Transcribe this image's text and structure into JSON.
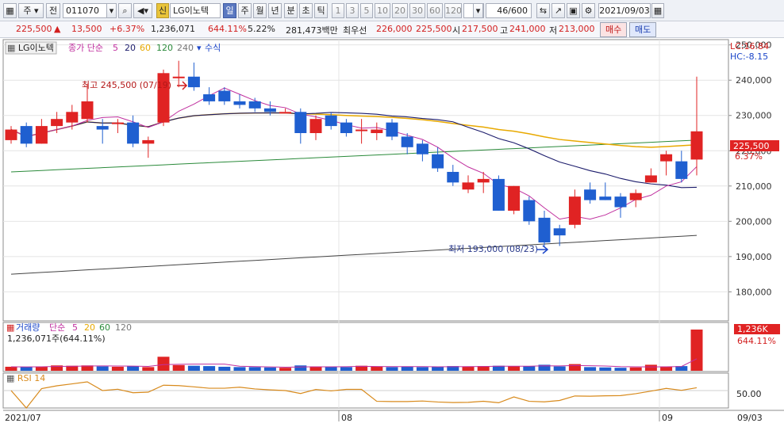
{
  "toolbar": {
    "period_type": "주",
    "prev_label": "전",
    "code": "011070",
    "stock_tag": "신",
    "stock_name": "LG이노텍",
    "intervals": [
      "일",
      "주",
      "월",
      "년",
      "분",
      "초",
      "틱"
    ],
    "selected_interval": "일",
    "numbers": [
      "1",
      "3",
      "5",
      "10",
      "20",
      "30",
      "60",
      "120"
    ],
    "count": "46/600",
    "date": "2021/09/03"
  },
  "quote": {
    "price": "225,500",
    "change_arrow": "▲",
    "change": "13,500",
    "change_rate": "+6.37%",
    "volume": "1,236,071",
    "volume_rate": "644.11%",
    "turnover": "5.22%",
    "amount": "281,473백만",
    "best_label": "최우선",
    "best_ask": "226,000",
    "best_bid": "225,500",
    "open_label": "시",
    "open": "217,500",
    "high_label": "고",
    "high": "241,000",
    "low_label": "저",
    "low": "213,000",
    "buy_label": "매수",
    "sell_label": "매도"
  },
  "chart": {
    "price_legend": {
      "name": "LG이노텍",
      "ma_label": "종가 단순",
      "ma_periods": [
        "5",
        "20",
        "60",
        "120",
        "240"
      ],
      "formula_label": "수식"
    },
    "corner_info": {
      "lc": "LC:16.84",
      "hc": "HC:-8.15"
    },
    "current_price_tag": "225,500",
    "current_rate_tag": "6.37%",
    "high_annotation": "최고 245,500 (07/19)",
    "low_annotation": "최저 193,000 (08/23)",
    "volume_legend": {
      "name": "거래량",
      "ma_label": "단순",
      "ma_periods": [
        "5",
        "20",
        "60",
        "120"
      ],
      "value_text": "1,236,071주(644.11%)"
    },
    "volume_tag": {
      "value": "1,236K",
      "rate": "644.11%"
    },
    "rsi_legend": "RSI 14",
    "rsi_tick": "50.00",
    "date_labels": [
      "2021/07",
      "08",
      "09",
      "09/03"
    ],
    "colors": {
      "up": "#e02323",
      "down": "#1f5fd0",
      "ma5": "#c0309f",
      "ma20": "#1b1b6b",
      "ma60": "#e8a900",
      "ma120": "#2a8a3a",
      "ma240": "#444444",
      "rsi": "#d88a1c"
    }
  },
  "chart_data": {
    "type": "candlestick",
    "y_axis_ticks": [
      180000,
      190000,
      200000,
      210000,
      220000,
      230000,
      240000,
      250000
    ],
    "ylim": [
      172000,
      251500
    ],
    "candles": [
      {
        "o": 223000,
        "h": 227000,
        "l": 222000,
        "c": 226000
      },
      {
        "o": 227000,
        "h": 228000,
        "l": 221000,
        "c": 222000
      },
      {
        "o": 222000,
        "h": 229000,
        "l": 222000,
        "c": 227000
      },
      {
        "o": 227000,
        "h": 231000,
        "l": 225000,
        "c": 229000
      },
      {
        "o": 228000,
        "h": 233000,
        "l": 226000,
        "c": 231000
      },
      {
        "o": 229000,
        "h": 239000,
        "l": 228000,
        "c": 234000
      },
      {
        "o": 227000,
        "h": 229000,
        "l": 222000,
        "c": 226000
      },
      {
        "o": 228000,
        "h": 229000,
        "l": 225000,
        "c": 228000
      },
      {
        "o": 228000,
        "h": 230000,
        "l": 221000,
        "c": 222000
      },
      {
        "o": 222000,
        "h": 224000,
        "l": 218000,
        "c": 223000
      },
      {
        "o": 228000,
        "h": 243000,
        "l": 227000,
        "c": 242000
      },
      {
        "o": 241000,
        "h": 245500,
        "l": 238000,
        "c": 241000
      },
      {
        "o": 241000,
        "h": 245000,
        "l": 237000,
        "c": 238000
      },
      {
        "o": 236000,
        "h": 238000,
        "l": 233000,
        "c": 234000
      },
      {
        "o": 237000,
        "h": 238000,
        "l": 233000,
        "c": 234000
      },
      {
        "o": 234000,
        "h": 236000,
        "l": 232000,
        "c": 233000
      },
      {
        "o": 234000,
        "h": 235000,
        "l": 231000,
        "c": 232000
      },
      {
        "o": 232000,
        "h": 234000,
        "l": 230000,
        "c": 231000
      },
      {
        "o": 231000,
        "h": 232000,
        "l": 231000,
        "c": 231000
      },
      {
        "o": 231000,
        "h": 232000,
        "l": 222000,
        "c": 225000
      },
      {
        "o": 225000,
        "h": 230000,
        "l": 223000,
        "c": 229000
      },
      {
        "o": 230000,
        "h": 231000,
        "l": 226000,
        "c": 227000
      },
      {
        "o": 228000,
        "h": 229000,
        "l": 224000,
        "c": 225000
      },
      {
        "o": 226000,
        "h": 229000,
        "l": 222000,
        "c": 226000
      },
      {
        "o": 225000,
        "h": 228000,
        "l": 223000,
        "c": 226000
      },
      {
        "o": 228000,
        "h": 229000,
        "l": 223000,
        "c": 224000
      },
      {
        "o": 224000,
        "h": 225000,
        "l": 219000,
        "c": 221000
      },
      {
        "o": 222000,
        "h": 223000,
        "l": 217000,
        "c": 219000
      },
      {
        "o": 219000,
        "h": 221000,
        "l": 214000,
        "c": 215000
      },
      {
        "o": 214000,
        "h": 216000,
        "l": 210000,
        "c": 211000
      },
      {
        "o": 209000,
        "h": 213000,
        "l": 208000,
        "c": 211000
      },
      {
        "o": 211000,
        "h": 214000,
        "l": 208000,
        "c": 212000
      },
      {
        "o": 212000,
        "h": 213000,
        "l": 203000,
        "c": 203000
      },
      {
        "o": 203000,
        "h": 210000,
        "l": 202000,
        "c": 210000
      },
      {
        "o": 206000,
        "h": 207000,
        "l": 199000,
        "c": 200000
      },
      {
        "o": 201000,
        "h": 203000,
        "l": 193000,
        "c": 194000
      },
      {
        "o": 198000,
        "h": 199000,
        "l": 193000,
        "c": 196000
      },
      {
        "o": 199000,
        "h": 209000,
        "l": 198000,
        "c": 207000
      },
      {
        "o": 209000,
        "h": 211000,
        "l": 205000,
        "c": 206000
      },
      {
        "o": 207000,
        "h": 211000,
        "l": 206000,
        "c": 206000
      },
      {
        "o": 207000,
        "h": 208000,
        "l": 201000,
        "c": 204000
      },
      {
        "o": 206000,
        "h": 209000,
        "l": 204000,
        "c": 208000
      },
      {
        "o": 211000,
        "h": 215000,
        "l": 211000,
        "c": 213000
      },
      {
        "o": 217000,
        "h": 220000,
        "l": 213000,
        "c": 219000
      },
      {
        "o": 217000,
        "h": 220000,
        "l": 211000,
        "c": 212000
      },
      {
        "o": 217500,
        "h": 241000,
        "l": 213000,
        "c": 225500
      }
    ],
    "volume_thousands": [
      120,
      110,
      130,
      160,
      150,
      160,
      130,
      120,
      140,
      110,
      420,
      170,
      150,
      140,
      120,
      110,
      110,
      100,
      90,
      160,
      130,
      120,
      110,
      150,
      130,
      110,
      120,
      110,
      130,
      140,
      120,
      140,
      150,
      130,
      140,
      180,
      130,
      200,
      110,
      100,
      90,
      100,
      180,
      130,
      140,
      1236
    ],
    "ma_approx": {
      "ma120_start": 214000,
      "ma120_end": 223000,
      "ma240_start": 185000,
      "ma240_end": 196000
    },
    "rsi_reference": 50
  }
}
